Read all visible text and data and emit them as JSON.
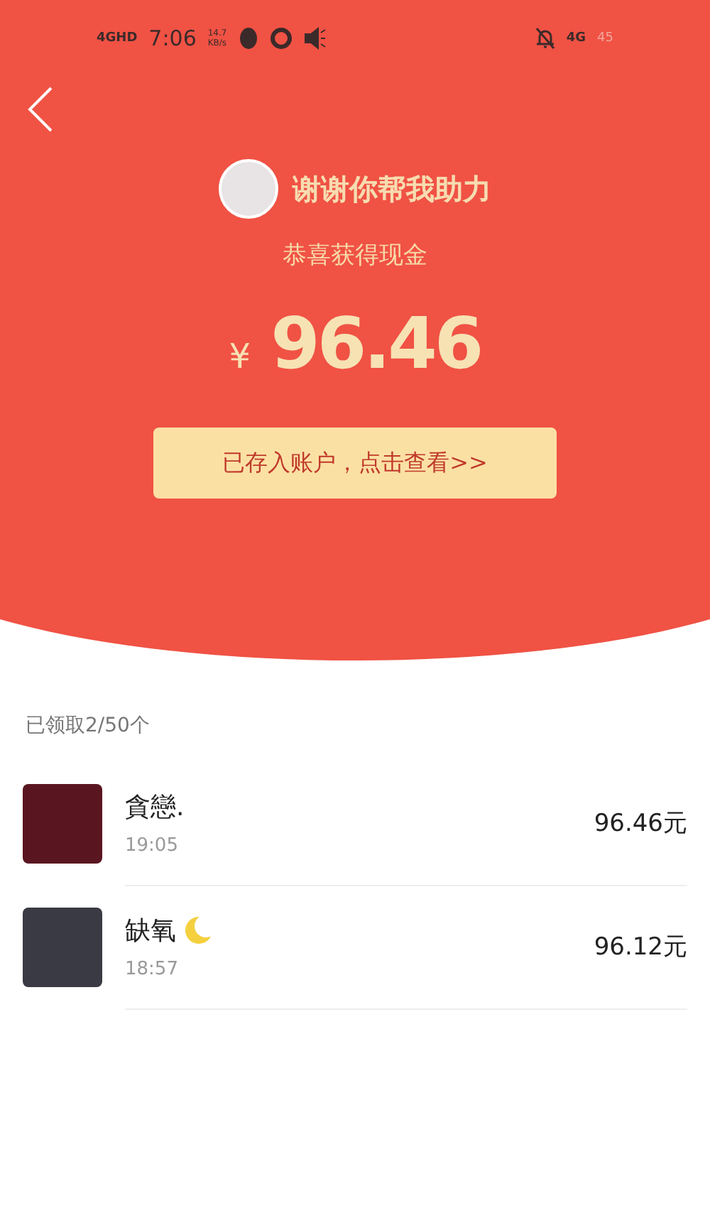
{
  "status_bar": {
    "network": "4G",
    "network_badge": "HD",
    "time": "7:06",
    "speed": "14.7",
    "speed_unit": "KB/s",
    "mobile": "4G",
    "battery": "45"
  },
  "header": {
    "title": "谢谢你帮我助力",
    "subtitle": "恭喜获得现金",
    "currency": "¥",
    "amount": "96.46",
    "button": "已存入账户，点击查看>>"
  },
  "summary": "已领取2/50个",
  "records": [
    {
      "name": "貪戀.",
      "time": "19:05",
      "amount": "96.46元",
      "emoji": false
    },
    {
      "name": "缺氧",
      "time": "18:57",
      "amount": "96.12元",
      "emoji": true
    }
  ]
}
